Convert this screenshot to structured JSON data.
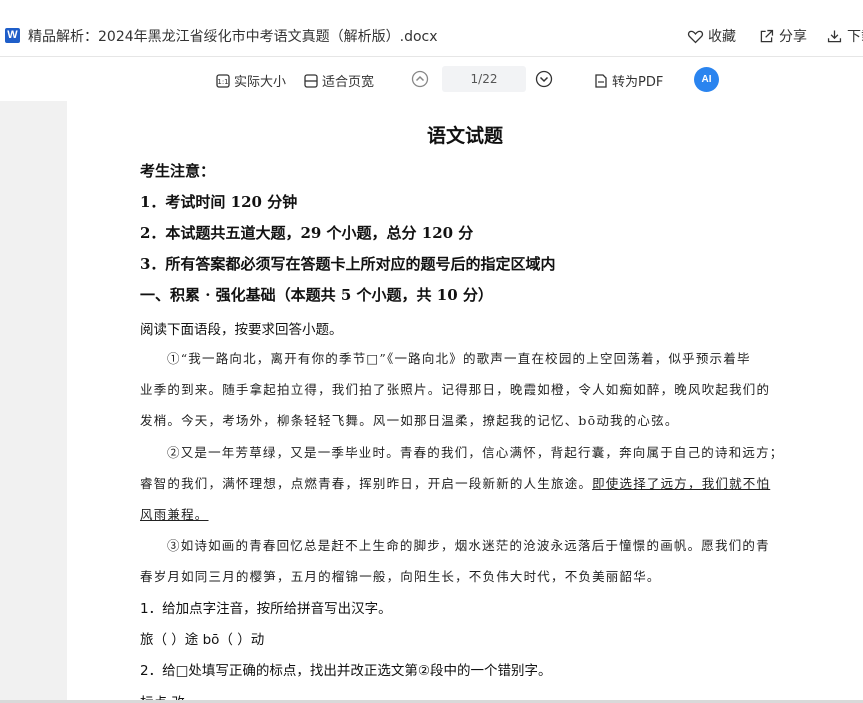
{
  "window": {
    "app_icon_letter": "W",
    "doc_title": "精品解析：2024年黑龙江省绥化市中考语文真题（解析版）.docx",
    "actions": {
      "favorite": "收藏",
      "share": "分享",
      "download": "下载"
    }
  },
  "toolbar": {
    "actual_size": "实际大小",
    "fit_width": "适合页宽",
    "page_indicator": "1/22",
    "to_pdf": "转为PDF",
    "ai_label": "AI"
  },
  "document": {
    "title": "语文试题",
    "notice_heading": "考生注意：",
    "notices": [
      "1．考试时间 120 分钟",
      "2．本试题共五道大题，29 个小题，总分 120 分",
      "3．所有答案都必须写在答题卡上所对应的题号后的指定区域内"
    ],
    "section1": "一、积累 · 强化基础（本题共 5 个小题，共 10 分）",
    "instruction": "阅读下面语段，按要求回答小题。",
    "passage": {
      "p1_l1": "①“我一路向北，离开有你的季节□”《一路向北》的歌声一直在校园的上空回荡着，似乎预示着毕",
      "p1_l2": "业季的到来。随手拿起拍立得，我们拍了张照片。记得那日，晚霞如橙，令人如痴如醉，晚风吹起我们的",
      "p1_l3": "发梢。今天，考场外，柳条轻轻飞舞。风一如那日温柔，撩起我的记忆、bō动我的心弦。",
      "p2_l1": "②又是一年芳草绿，又是一季毕业时。青春的我们，信心满怀，背起行囊，奔向属于自己的诗和远方；",
      "p2_l2_a": "睿智的我们，满怀理想，点燃青春，挥别昨日，开启一段新新的人生旅途。",
      "p2_l2_b": "即使选择了远方，我们就不怕",
      "p2_l3": "风雨兼程。",
      "p3_l1": "③如诗如画的青春回忆总是赶不上生命的脚步，烟水迷茫的沧波永远落后于憧憬的画帆。愿我们的青",
      "p3_l2": "春岁月如同三月的樱笋，五月的榴锦一般，向阳生长，不负伟大时代，不负美丽韶华。"
    },
    "q1": "1．给加点字注音，按所给拼音写出汉字。",
    "q1_blanks": "旅（        ）途      bō（          ）动",
    "q2": "2．给□处填写正确的标点，找出并改正选文第②段中的一个错别字。",
    "q2_partial": "标点                          改"
  }
}
